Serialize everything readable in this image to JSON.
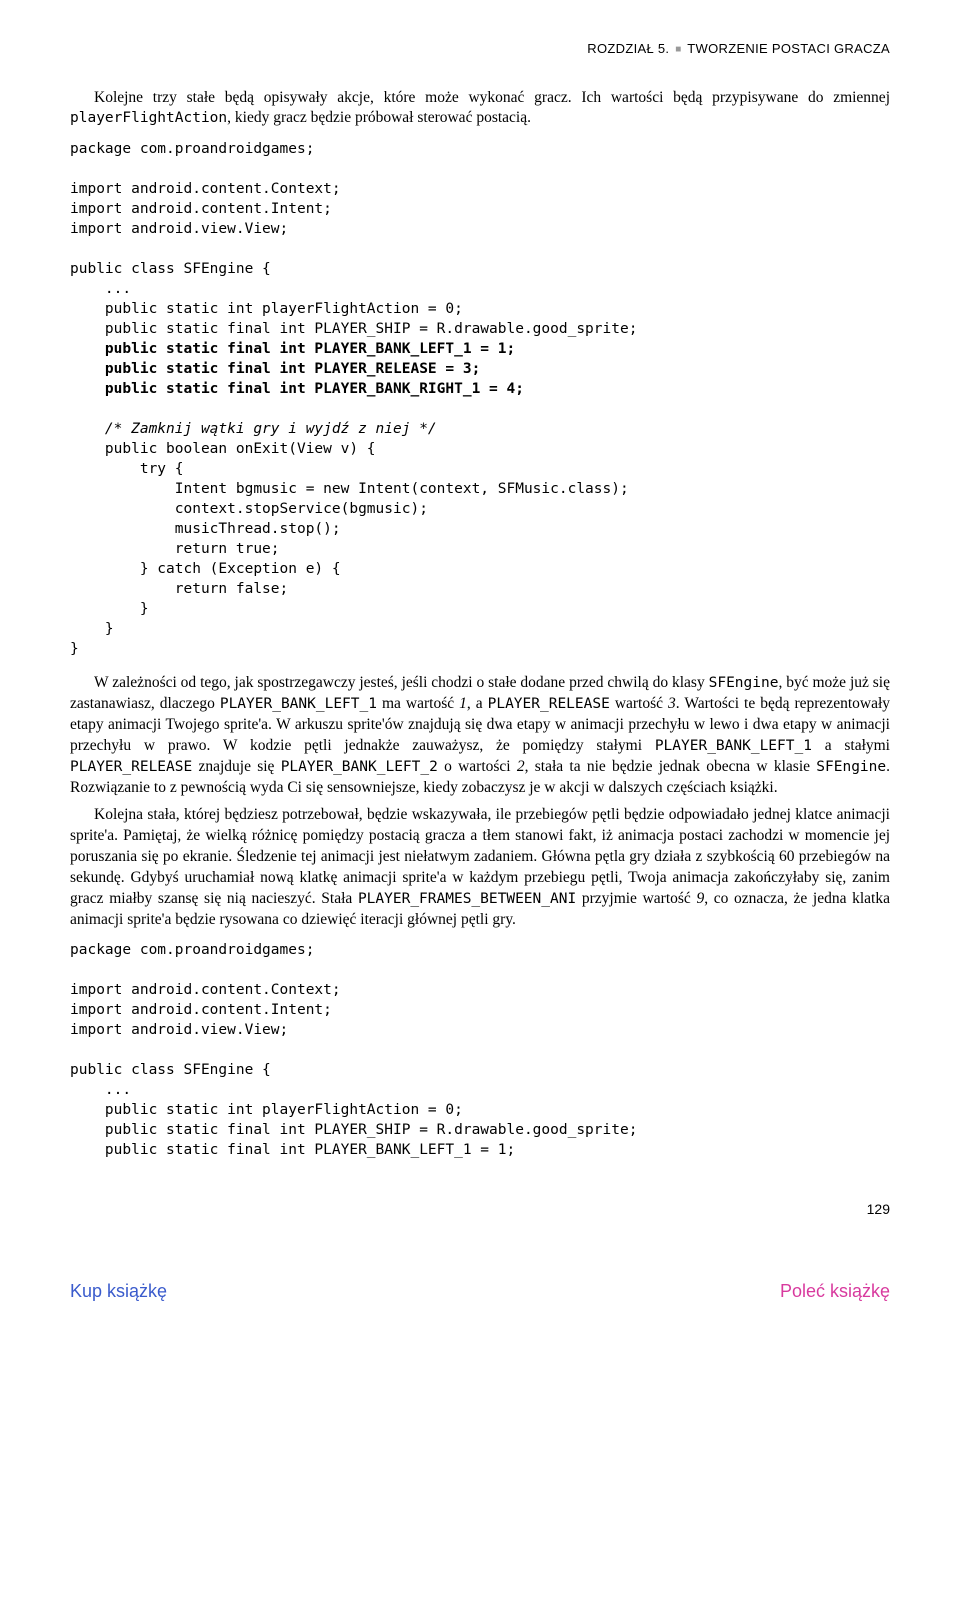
{
  "header": {
    "chapter": "ROZDZIAŁ 5.",
    "title": "TWORZENIE POSTACI GRACZA"
  },
  "para1": "Kolejne trzy stałe będą opisywały akcje, które może wykonać gracz. Ich wartości będą przypisywane do zmiennej ",
  "para1_code": "playerFlightAction",
  "para1_tail": ", kiedy gracz będzie próbował sterować postacią.",
  "code1": {
    "l1": "package com.proandroidgames;",
    "l2": "",
    "l3": "import android.content.Context;",
    "l4": "import android.content.Intent;",
    "l5": "import android.view.View;",
    "l6": "",
    "l7": "public class SFEngine {",
    "l8": "    ...",
    "l9": "    public static int playerFlightAction = 0;",
    "l10": "    public static final int PLAYER_SHIP = R.drawable.good_sprite;",
    "l11": "    public static final int PLAYER_BANK_LEFT_1 = 1;",
    "l12": "    public static final int PLAYER_RELEASE = 3;",
    "l13": "    public static final int PLAYER_BANK_RIGHT_1 = 4;",
    "l14": "",
    "l15_comment": "    /* Zamknij wątki gry i wyjdź z niej */",
    "l16": "    public boolean onExit(View v) {",
    "l17": "        try {",
    "l18": "            Intent bgmusic = new Intent(context, SFMusic.class);",
    "l19": "            context.stopService(bgmusic);",
    "l20": "            musicThread.stop();",
    "l21": "            return true;",
    "l22": "        } catch (Exception e) {",
    "l23": "            return false;",
    "l24": "        }",
    "l25": "    }",
    "l26": "}"
  },
  "para2_a": "W zależności od tego, jak spostrzegawczy jesteś, jeśli chodzi o stałe dodane przed chwilą do klasy ",
  "para2_c1": "SFEngine",
  "para2_b": ", być może już się zastanawiasz, dlaczego ",
  "para2_c2": "PLAYER_BANK_LEFT_1",
  "para2_c": " ma wartość ",
  "para2_i1": "1",
  "para2_d": ", a ",
  "para2_c3": "PLAYER_RELEASE",
  "para2_e": " wartość ",
  "para2_i2": "3",
  "para2_f": ". Wartości te będą reprezentowały etapy animacji Twojego sprite'a. W arkuszu sprite'ów znajdują się dwa etapy w animacji przechyłu w lewo i dwa etapy w animacji przechyłu w prawo. W kodzie pętli jednakże zauważysz, że pomiędzy stałymi ",
  "para2_c4": "PLAYER_BANK_LEFT_1",
  "para2_g": " a stałymi ",
  "para2_c5": "PLAYER_RELEASE",
  "para2_h": " znajduje się ",
  "para2_c6": "PLAYER_BANK_LEFT_2",
  "para2_i": " o wartości ",
  "para2_i3": "2",
  "para2_j": ", stała ta nie będzie jednak obecna w klasie ",
  "para2_c7": "SFEngine",
  "para2_k": ". Rozwiązanie to z pewnością wyda Ci się sensowniejsze, kiedy zobaczysz je w akcji w dalszych częściach książki.",
  "para3_a": "Kolejna stała, której będziesz potrzebował, będzie wskazywała, ile przebiegów pętli będzie odpowiadało jednej klatce animacji sprite'a. Pamiętaj, że wielką różnicę pomiędzy postacią gracza a tłem stanowi fakt, iż animacja postaci zachodzi w momencie jej poruszania się po ekranie. Śledzenie tej animacji jest niełatwym zadaniem. Główna pętla gry działa z szybkością 60 przebiegów na sekundę. Gdybyś uruchamiał nową klatkę animacji sprite'a w każdym przebiegu pętli, Twoja animacja zakończyłaby się, zanim gracz miałby szansę się nią nacieszyć. Stała ",
  "para3_c1": "PLAYER_FRAMES_BETWEEN_ANI",
  "para3_b": " przyjmie wartość ",
  "para3_i1": "9",
  "para3_c": ", co oznacza, że jedna klatka animacji sprite'a będzie rysowana co dziewięć iteracji głównej pętli gry.",
  "code2": {
    "l1": "package com.proandroidgames;",
    "l2": "",
    "l3": "import android.content.Context;",
    "l4": "import android.content.Intent;",
    "l5": "import android.view.View;",
    "l6": "",
    "l7": "public class SFEngine {",
    "l8": "    ...",
    "l9": "    public static int playerFlightAction = 0;",
    "l10": "    public static final int PLAYER_SHIP = R.drawable.good_sprite;",
    "l11": "    public static final int PLAYER_BANK_LEFT_1 = 1;"
  },
  "pagenum": "129",
  "footer": {
    "left": "Kup książkę",
    "right": "Poleć książkę"
  }
}
